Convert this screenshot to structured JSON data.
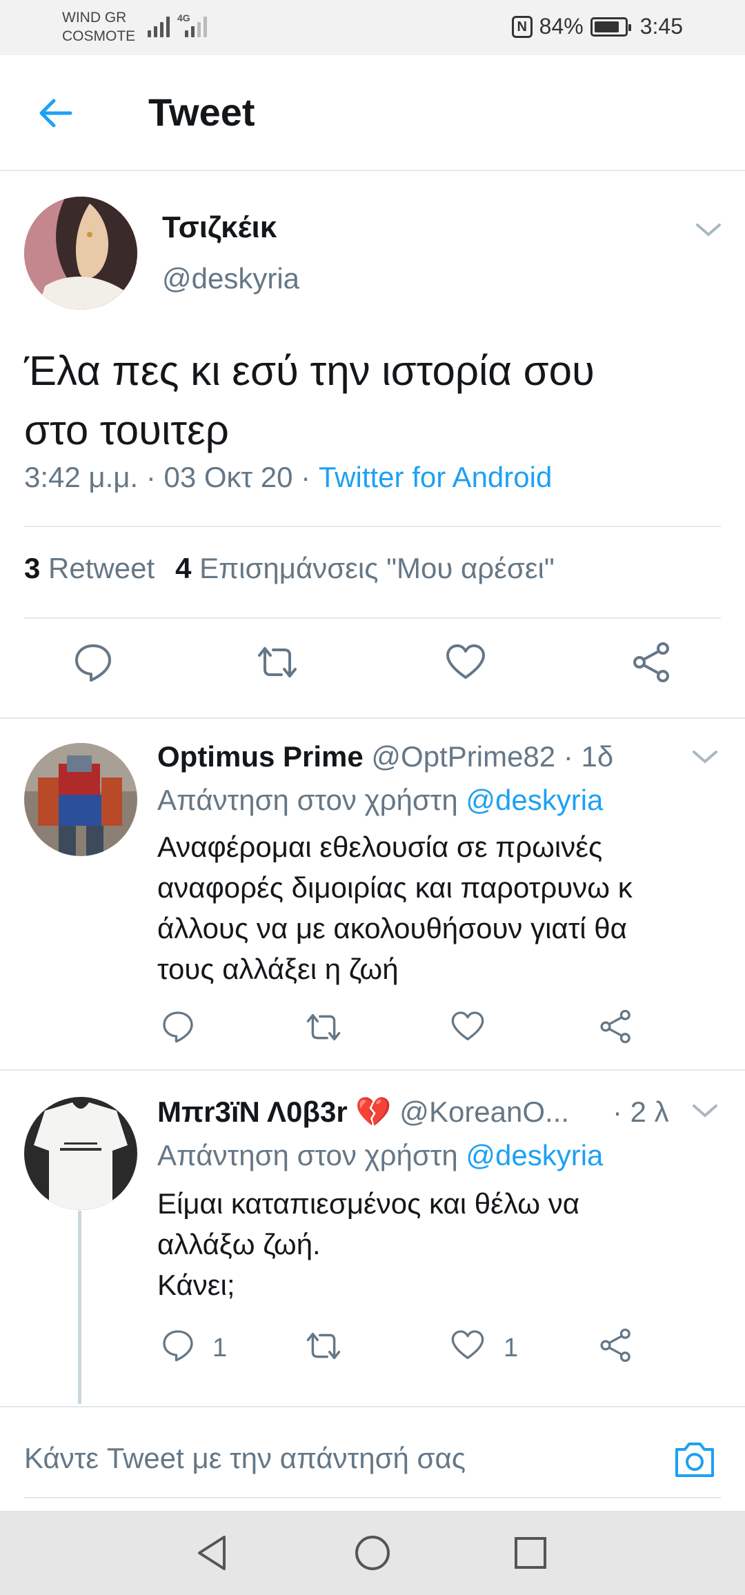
{
  "status_bar": {
    "carrier_line1": "WIND GR",
    "carrier_line2": "COSMOTE",
    "network_type": "4G",
    "nfc_label": "N",
    "battery_percent_text": "84%",
    "battery_level": 0.84,
    "time": "3:45"
  },
  "header": {
    "back_icon": "arrow-left-icon",
    "title": "Tweet"
  },
  "tweet": {
    "name": "Τσιζκέικ",
    "handle": "@deskyria",
    "text_line1": "Έλα πες κι εσύ την ιστορία σου",
    "text_line2": "στο τουιτερ",
    "time": "3:42 μ.μ. · 03 Οκτ 20 · ",
    "source": "Twitter for Android",
    "retweet_count": "3",
    "retweet_label": "Retweet",
    "like_count": "4",
    "like_label": "Επισημάνσεις \"Μου αρέσει\""
  },
  "replies": [
    {
      "name": "Optimus Prime",
      "handle_time": " @OptPrime82 · 1δ",
      "replying_prefix": "Απάντηση στον χρήστη ",
      "replying_to": "@deskyria",
      "lines": [
        "Αναφέρομαι εθελουσία σε πρωινές",
        "αναφορές διμοιρίας και παροτρυνω κ",
        "άλλους να με ακολουθήσουν γιατί θα",
        "τους αλλάξει η ζωή"
      ],
      "reply_count": "",
      "like_count": ""
    },
    {
      "name": "Μπr3ïΝ Λ0β3r",
      "emoji": "💔",
      "handle": " @KoreanO...",
      "time": "· 2 λ",
      "replying_prefix": "Απάντηση στον χρήστη ",
      "replying_to": "@deskyria",
      "lines": [
        "Είμαι καταπιεσμένος και θέλω να",
        "αλλάξω ζωή.",
        "Κάνει;"
      ],
      "reply_count": "1",
      "like_count": "1"
    }
  ],
  "compose": {
    "placeholder": "Κάντε Tweet με την απάντησή σας",
    "camera_icon": "camera-icon"
  },
  "colors": {
    "accent": "#1da1f2",
    "secondary_text": "#657786",
    "divider": "#e1e8ed"
  }
}
